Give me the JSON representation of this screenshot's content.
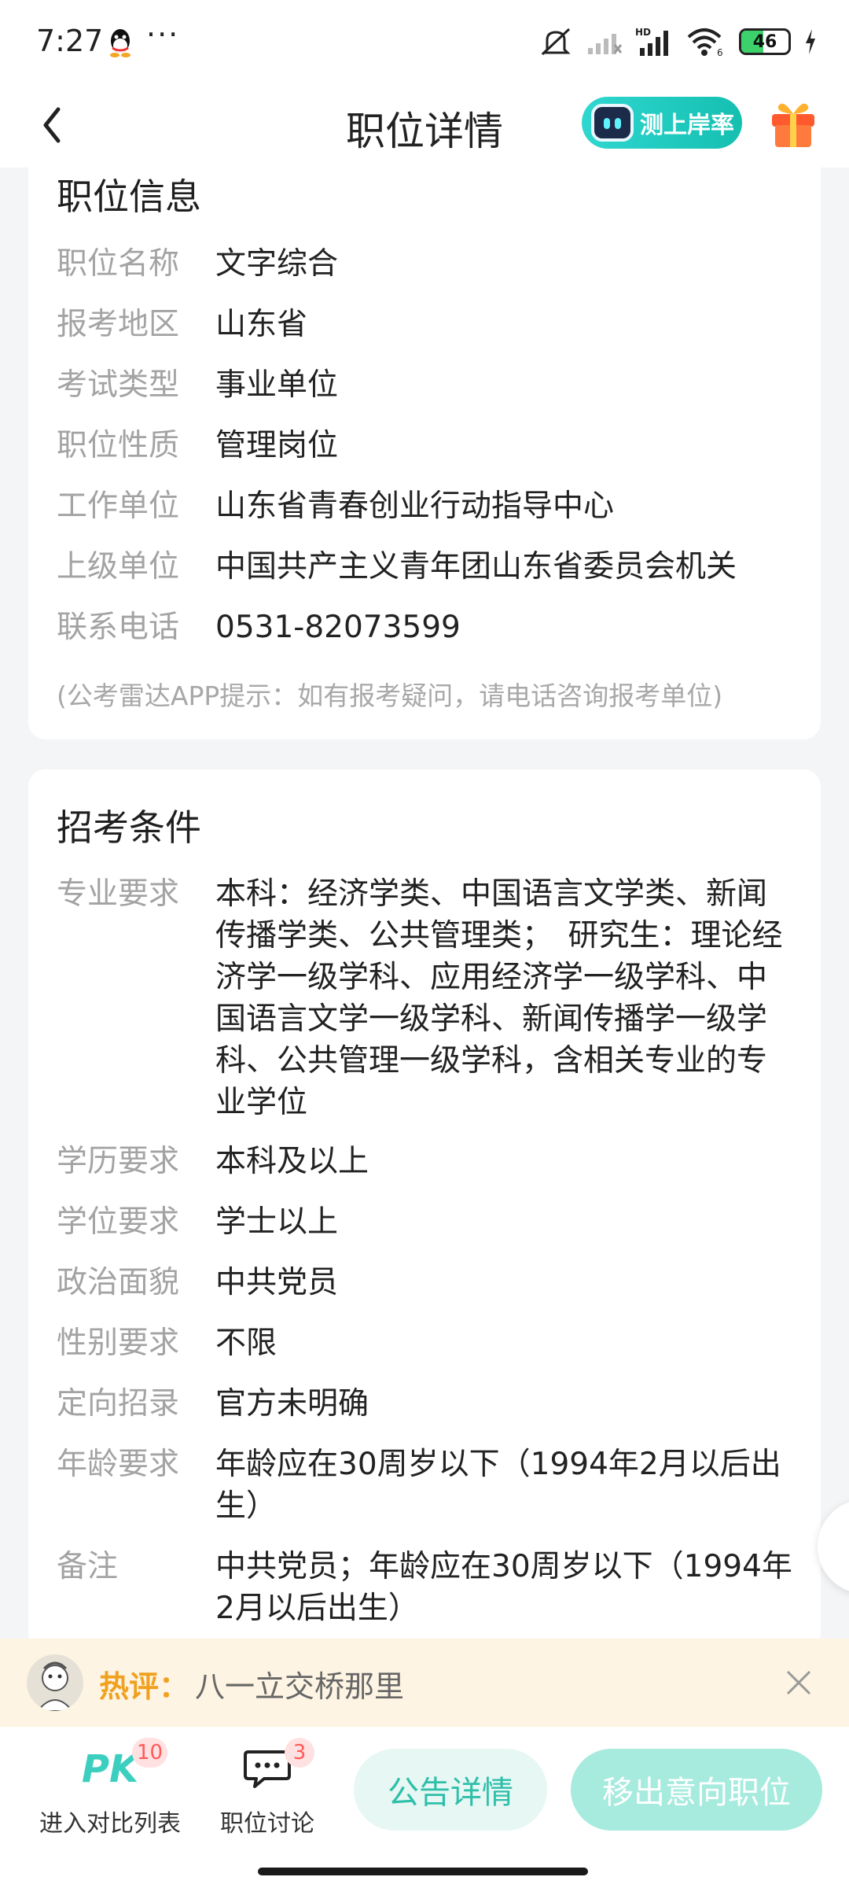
{
  "status_bar": {
    "time": "7:27",
    "more_icon": "more-dots",
    "icons": [
      "qq-icon",
      "mute-icon",
      "signal-icon",
      "hd-signal-icon",
      "wifi-icon",
      "battery-icon",
      "charging-icon"
    ],
    "battery_level": 46
  },
  "nav": {
    "title": "职位详情",
    "pill_label": "测上岸率"
  },
  "position_info": {
    "title": "职位信息",
    "rows": [
      {
        "label": "职位名称",
        "value": "文字综合"
      },
      {
        "label": "报考地区",
        "value": "山东省"
      },
      {
        "label": "考试类型",
        "value": "事业单位"
      },
      {
        "label": "职位性质",
        "value": "管理岗位"
      },
      {
        "label": "工作单位",
        "value": "山东省青春创业行动指导中心"
      },
      {
        "label": "上级单位",
        "value": "中国共产主义青年团山东省委员会机关"
      },
      {
        "label": "联系电话",
        "value": "0531-82073599"
      }
    ],
    "hint": "(公考雷达APP提示：如有报考疑问，请电话咨询报考单位)"
  },
  "requirements": {
    "title": "招考条件",
    "rows": [
      {
        "label": "专业要求",
        "value": "本科：经济学类、中国语言文学类、新闻传播学类、公共管理类；　研究生：理论经济学一级学科、应用经济学一级学科、中国语言文学一级学科、新闻传播学一级学科、公共管理一级学科，含相关专业的专业学位"
      },
      {
        "label": "学历要求",
        "value": "本科及以上"
      },
      {
        "label": "学位要求",
        "value": "学士以上"
      },
      {
        "label": "政治面貌",
        "value": "中共党员"
      },
      {
        "label": "性别要求",
        "value": "不限"
      },
      {
        "label": "定向招录",
        "value": "官方未明确"
      },
      {
        "label": "年龄要求",
        "value": "年龄应在30周岁以下（1994年2月以后出生）"
      },
      {
        "label": "备注",
        "value": "中共党员；年龄应在30周岁以下（1994年2月以后出生）"
      }
    ]
  },
  "hot_comment": {
    "label": "热评：",
    "text": "八一立交桥那里"
  },
  "bottom": {
    "compare_icon": "PK",
    "compare_label": "进入对比列表",
    "compare_badge": "10",
    "discuss_label": "职位讨论",
    "discuss_badge": "3",
    "notice_label": "公告详情",
    "remove_label": "移出意向职位"
  },
  "colors": {
    "accent": "#2ebfa9",
    "hot_label": "#f0a11f",
    "badge": "#ff5a5a"
  }
}
